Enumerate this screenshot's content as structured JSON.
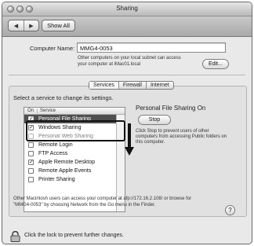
{
  "window": {
    "title": "Sharing"
  },
  "toolbar": {
    "show_all_label": "Show All",
    "back_icon": "chevron-left-icon",
    "forward_icon": "chevron-right-icon"
  },
  "computer_name": {
    "label": "Computer Name:",
    "value": "MMG4-0053",
    "help_text_line1": "Other computers on your local subnet can access",
    "help_text_line2": "your computer at iMac01.local",
    "edit_button": "Edit..."
  },
  "tabs": [
    {
      "label": "Services",
      "active": true
    },
    {
      "label": "Firewall",
      "active": false
    },
    {
      "label": "Internet",
      "active": false
    }
  ],
  "services": {
    "instruction": "Select a service to change its settings.",
    "header_on": "On",
    "header_service": "Service",
    "items": [
      {
        "label": "Personal File Sharing",
        "checked": true,
        "selected": true
      },
      {
        "label": "Windows Sharing",
        "checked": true,
        "selected": false
      },
      {
        "label": "Personal Web Sharing",
        "checked": false,
        "selected": false
      },
      {
        "label": "Remote Login",
        "checked": false,
        "selected": false
      },
      {
        "label": "FTP Access",
        "checked": false,
        "selected": false
      },
      {
        "label": "Apple Remote Desktop",
        "checked": true,
        "selected": false
      },
      {
        "label": "Remote Apple Events",
        "checked": false,
        "selected": false
      },
      {
        "label": "Printer Sharing",
        "checked": false,
        "selected": false
      }
    ]
  },
  "detail": {
    "status": "Personal File Sharing On",
    "stop_button": "Stop",
    "description_line1": "Click Stop to prevent users of other",
    "description_line2": "computers from accessing Public folders on",
    "description_line3": "this computer."
  },
  "footer": {
    "info_line1": "Other Macintosh users can access your computer at afp://172.16.2.108/ or browse for",
    "info_line2": "\"MMG4-0053\" by choosing Network from the Go menu in the Finder.",
    "help_symbol": "?",
    "lock_text": "Click the lock to prevent further changes."
  },
  "colors": {
    "selection": "#4f4f4f",
    "window_bg": "#e9e9e9"
  }
}
